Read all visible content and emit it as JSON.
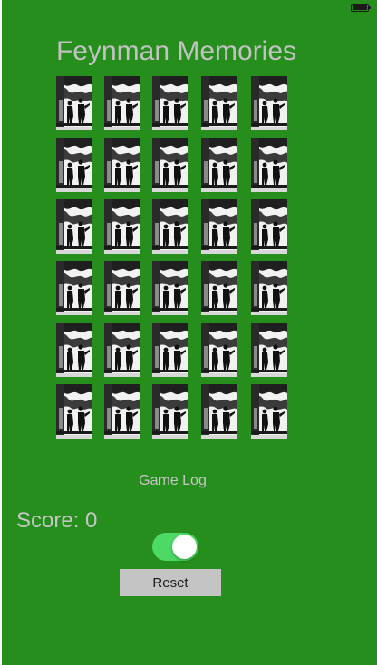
{
  "title": "Feynman Memories",
  "grid": {
    "rows": 6,
    "columns": 5,
    "card_image": "feynman-photo"
  },
  "game_log_label": "Game Log",
  "score_label": "Score: 0",
  "toggle": {
    "on": true,
    "color": "#4cd964"
  },
  "reset_label": "Reset",
  "colors": {
    "background": "#268e1c",
    "text": "#c6c6c6",
    "button": "#c4c4c4"
  }
}
